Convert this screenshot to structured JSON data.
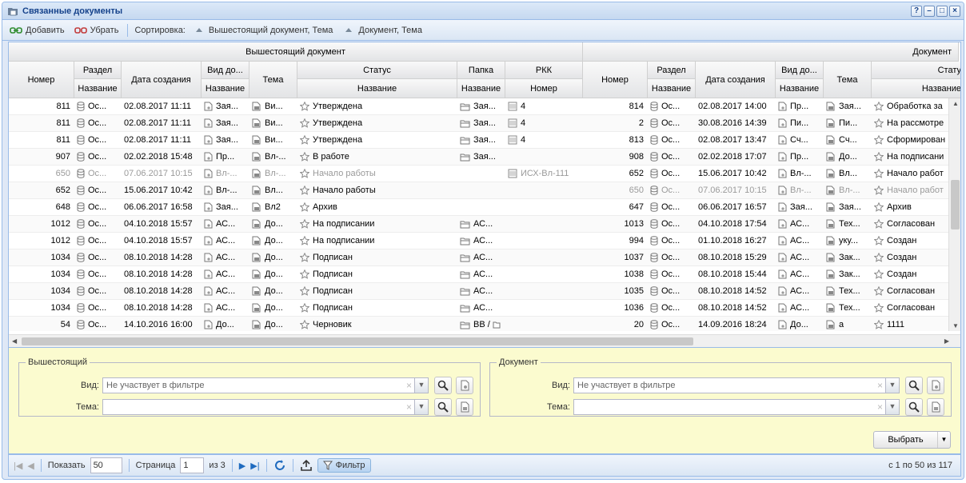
{
  "window": {
    "title": "Связанные документы"
  },
  "toolbar": {
    "add": "Добавить",
    "remove": "Убрать",
    "sort_label": "Сортировка:",
    "sort1": "Вышестоящий документ, Тема",
    "sort2": "Документ, Тема"
  },
  "headers": {
    "group_left": "Вышестоящий документ",
    "group_right": "Документ",
    "number": "Номер",
    "section": "Раздел",
    "name": "Название",
    "created": "Дата создания",
    "doctype": "Вид до...",
    "topic": "Тема",
    "status": "Статус",
    "folder": "Папка",
    "rkk": "РКК",
    "rkk_number": "Номер",
    "status_right": "Стату"
  },
  "rows": [
    {
      "n1": "811",
      "r1": "Ос...",
      "d1": "02.08.2017 11:11",
      "v1": "Зая...",
      "t1": "Ви...",
      "s1": "Утверждена",
      "f1": "Зая...",
      "k1": "4",
      "n2": "814",
      "r2": "Ос...",
      "d2": "02.08.2017 14:00",
      "v2": "Пр...",
      "t2": "Зая...",
      "s2": "Обработка за"
    },
    {
      "n1": "811",
      "r1": "Ос...",
      "d1": "02.08.2017 11:11",
      "v1": "Зая...",
      "t1": "Ви...",
      "s1": "Утверждена",
      "f1": "Зая...",
      "k1": "4",
      "n2": "2",
      "r2": "Ос...",
      "d2": "30.08.2016 14:39",
      "v2": "Пи...",
      "t2": "Пи...",
      "s2": "На рассмотре"
    },
    {
      "n1": "811",
      "r1": "Ос...",
      "d1": "02.08.2017 11:11",
      "v1": "Зая...",
      "t1": "Ви...",
      "s1": "Утверждена",
      "f1": "Зая...",
      "k1": "4",
      "n2": "813",
      "r2": "Ос...",
      "d2": "02.08.2017 13:47",
      "v2": "Сч...",
      "t2": "Сч...",
      "s2": "Сформирован"
    },
    {
      "n1": "907",
      "r1": "Ос...",
      "d1": "02.02.2018 15:48",
      "v1": "Пр...",
      "t1": "Вл-...",
      "s1": "В работе",
      "f1": "Зая...",
      "k1": "",
      "n2": "908",
      "r2": "Ос...",
      "d2": "02.02.2018 17:07",
      "v2": "Пр...",
      "t2": "До...",
      "s2": "На подписани"
    },
    {
      "n1": "650",
      "r1": "Ос...",
      "d1": "07.06.2017 10:15",
      "v1": "Вл-...",
      "t1": "Вл-...",
      "s1": "Начало работы",
      "f1": "",
      "k1": "ИСХ-Вл-111",
      "n2": "652",
      "r2": "Ос...",
      "d2": "15.06.2017 10:42",
      "v2": "Вл-...",
      "t2": "Вл...",
      "s2": "Начало работ"
    },
    {
      "n1": "652",
      "r1": "Ос...",
      "d1": "15.06.2017 10:42",
      "v1": "Вл-...",
      "t1": "Вл...",
      "s1": "Начало работы",
      "f1": "",
      "k1": "",
      "n2": "650",
      "r2": "Ос...",
      "d2": "07.06.2017 10:15",
      "v2": "Вл-...",
      "t2": "Вл-...",
      "s2": "Начало работ"
    },
    {
      "n1": "648",
      "r1": "Ос...",
      "d1": "06.06.2017 16:58",
      "v1": "Зая...",
      "t1": "Вл2",
      "s1": "Архив",
      "f1": "",
      "k1": "",
      "n2": "647",
      "r2": "Ос...",
      "d2": "06.06.2017 16:57",
      "v2": "Зая...",
      "t2": "Зая...",
      "s2": "Архив"
    },
    {
      "n1": "1012",
      "r1": "Ос...",
      "d1": "04.10.2018 15:57",
      "v1": "АС...",
      "t1": "До...",
      "s1": "На подписании",
      "f1": "АС...",
      "k1": "",
      "n2": "1013",
      "r2": "Ос...",
      "d2": "04.10.2018 17:54",
      "v2": "АС...",
      "t2": "Тех...",
      "s2": "Согласован"
    },
    {
      "n1": "1012",
      "r1": "Ос...",
      "d1": "04.10.2018 15:57",
      "v1": "АС...",
      "t1": "До...",
      "s1": "На подписании",
      "f1": "АС...",
      "k1": "",
      "n2": "994",
      "r2": "Ос...",
      "d2": "01.10.2018 16:27",
      "v2": "АС...",
      "t2": "уку...",
      "s2": "Создан"
    },
    {
      "n1": "1034",
      "r1": "Ос...",
      "d1": "08.10.2018 14:28",
      "v1": "АС...",
      "t1": "До...",
      "s1": "Подписан",
      "f1": "АС...",
      "k1": "",
      "n2": "1037",
      "r2": "Ос...",
      "d2": "08.10.2018 15:29",
      "v2": "АС...",
      "t2": "Зак...",
      "s2": "Создан"
    },
    {
      "n1": "1034",
      "r1": "Ос...",
      "d1": "08.10.2018 14:28",
      "v1": "АС...",
      "t1": "До...",
      "s1": "Подписан",
      "f1": "АС...",
      "k1": "",
      "n2": "1038",
      "r2": "Ос...",
      "d2": "08.10.2018 15:44",
      "v2": "АС...",
      "t2": "Зак...",
      "s2": "Создан"
    },
    {
      "n1": "1034",
      "r1": "Ос...",
      "d1": "08.10.2018 14:28",
      "v1": "АС...",
      "t1": "До...",
      "s1": "Подписан",
      "f1": "АС...",
      "k1": "",
      "n2": "1035",
      "r2": "Ос...",
      "d2": "08.10.2018 14:52",
      "v2": "АС...",
      "t2": "Тех...",
      "s2": "Согласован"
    },
    {
      "n1": "1034",
      "r1": "Ос...",
      "d1": "08.10.2018 14:28",
      "v1": "АС...",
      "t1": "До...",
      "s1": "Подписан",
      "f1": "АС...",
      "k1": "",
      "n2": "1036",
      "r2": "Ос...",
      "d2": "08.10.2018 14:52",
      "v2": "АС...",
      "t2": "Тех...",
      "s2": "Согласован"
    },
    {
      "n1": "54",
      "r1": "Ос...",
      "d1": "14.10.2016 16:00",
      "v1": "До...",
      "t1": "До...",
      "s1": "Черновик",
      "f1": "ВВ /",
      "k1": "",
      "n2": "20",
      "r2": "Ос...",
      "d2": "14.09.2016 18:24",
      "v2": "До...",
      "t2": "а",
      "s2": "1111"
    }
  ],
  "filter": {
    "left_legend": "Вышестоящий",
    "right_legend": "Документ",
    "kind_label": "Вид:",
    "topic_label": "Тема:",
    "kind_placeholder": "Не участвует в фильтре",
    "choose": "Выбрать"
  },
  "pager": {
    "show_label": "Показать",
    "page_size": "50",
    "page_label": "Страница",
    "page": "1",
    "of": "из 3",
    "filter": "Фильтр",
    "info": "с 1 по 50 из 117"
  }
}
